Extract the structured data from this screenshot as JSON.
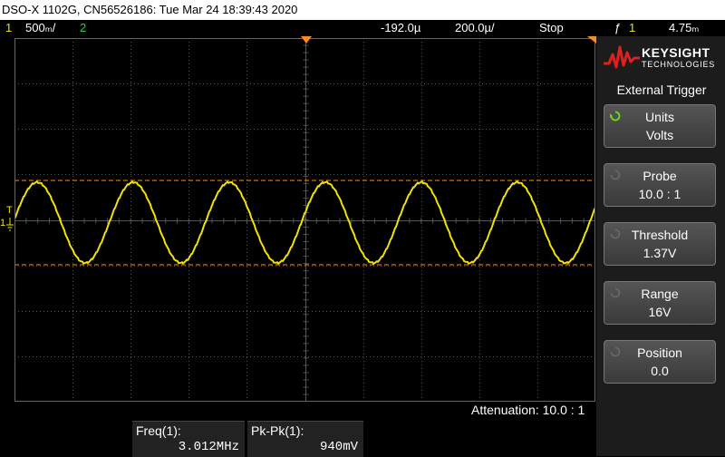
{
  "title": "DSO-X 1102G, CN56526186: Tue Mar 24 18:39:43 2020",
  "status": {
    "ch1_num": "1",
    "ch1_scale": "500ₘ/",
    "ch2_num": "2",
    "time_offset": "-192.0µ",
    "time_scale": "200.0µ/",
    "run_state": "Stop",
    "trigger_icon": "ƒ",
    "trigger_channel": "1",
    "trigger_level": "4.75ₘ"
  },
  "brand": {
    "name": "KEYSIGHT",
    "sub": "TECHNOLOGIES"
  },
  "menu": {
    "title": "External Trigger",
    "keys": [
      {
        "label": "Units",
        "value": "Volts"
      },
      {
        "label": "Probe",
        "value": "10.0 : 1"
      },
      {
        "label": "Threshold",
        "value": "1.37V"
      },
      {
        "label": "Range",
        "value": "16V"
      },
      {
        "label": "Position",
        "value": "0.0"
      }
    ]
  },
  "attenuation": "Attenuation: 10.0 : 1",
  "measurements": [
    {
      "label": "Freq(1):",
      "value": "3.012MHz"
    },
    {
      "label": "Pk-Pk(1):",
      "value": "940mV"
    }
  ],
  "markers": {
    "trigger_T": "T",
    "ch1_ground": "1"
  },
  "colors": {
    "ch1": "#f2e200",
    "ch2": "#2ecc40",
    "cursor": "#ff8c1a",
    "grid": "#555555"
  },
  "waveform": {
    "cycles": 6,
    "shape": "sine"
  }
}
